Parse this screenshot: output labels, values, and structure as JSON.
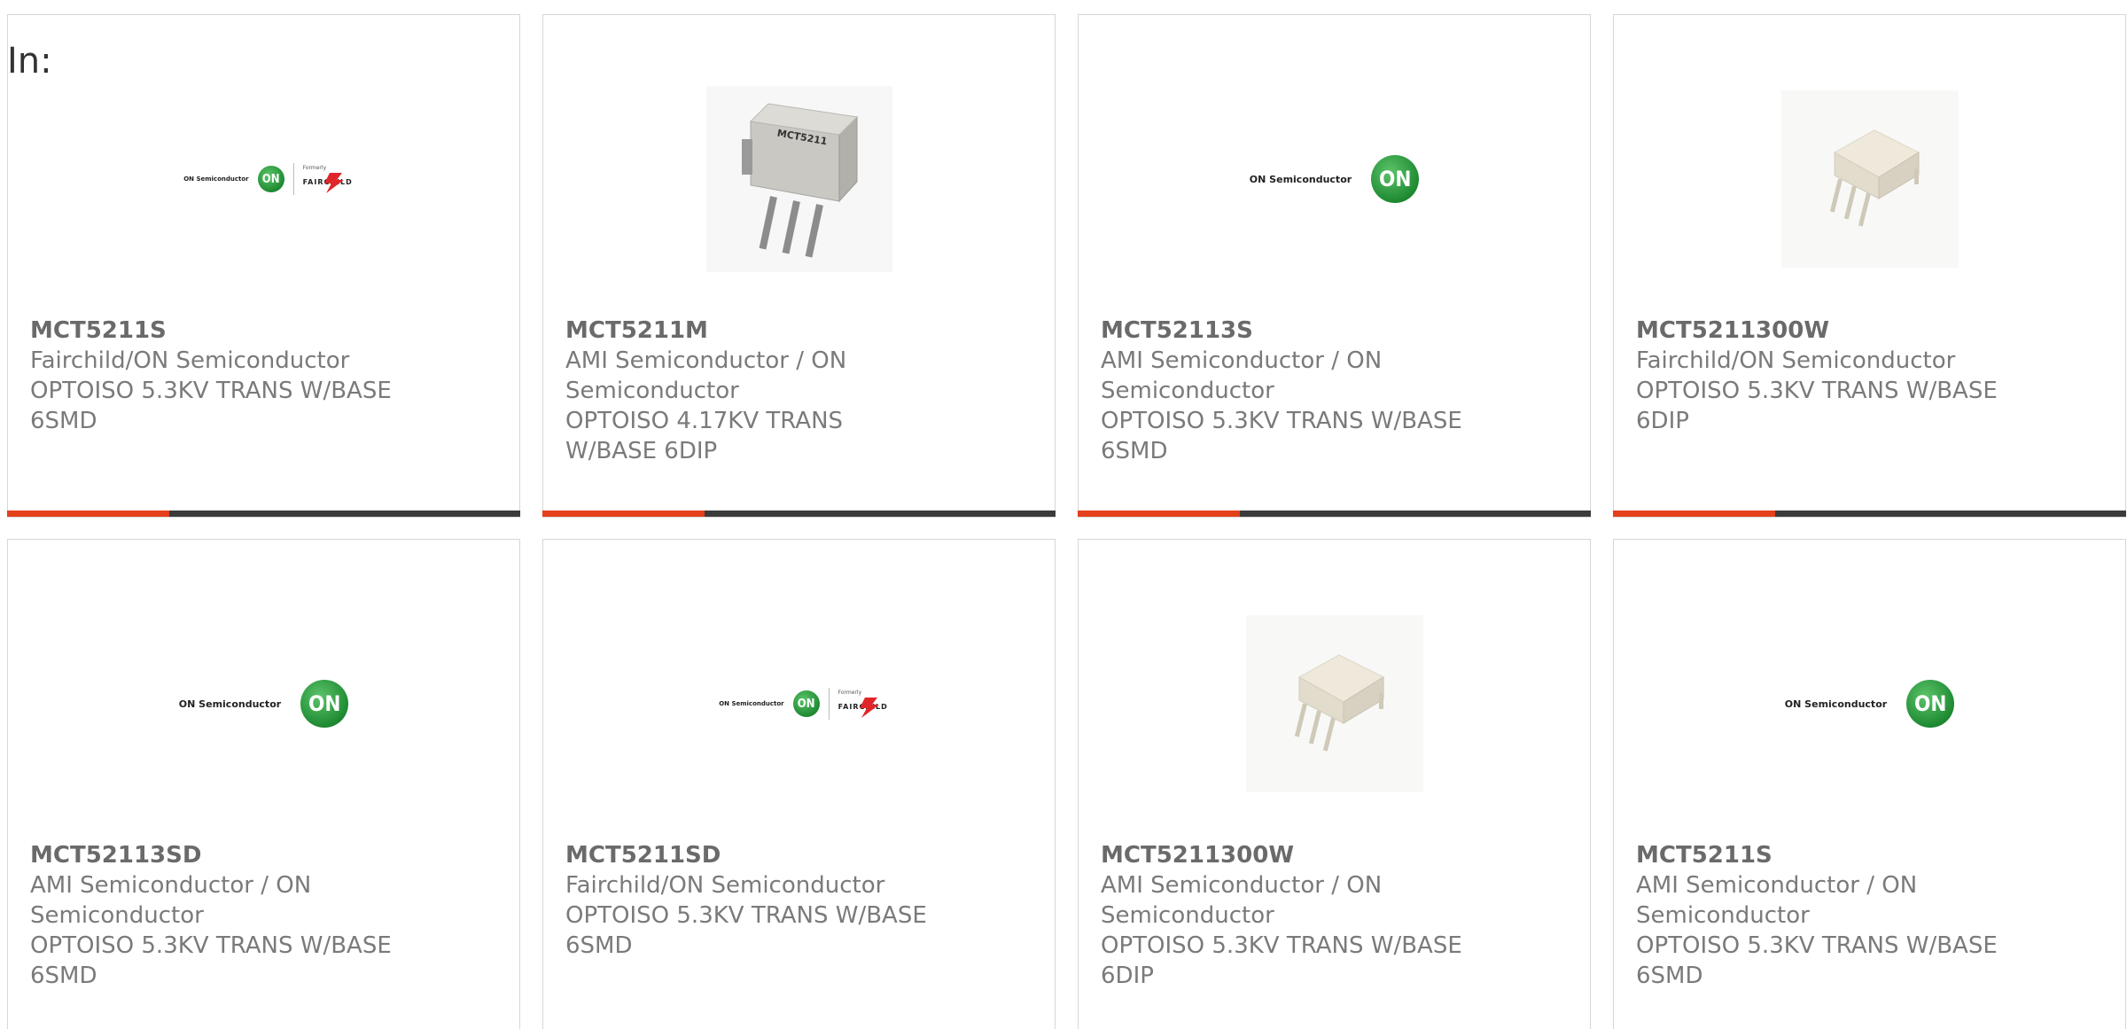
{
  "heading": "In:",
  "colors": {
    "accent": "#e4401b",
    "bar_dark": "#3b3b3b",
    "on_green": "#1e8a32",
    "fairchild_red": "#e0262a"
  },
  "logos": {
    "on_text": "ON Semiconductor",
    "on_mark": "ON",
    "fairchild_formerly": "Formerly",
    "fairchild_word": "FAIRCHILD",
    "chip_marking": "MCT5211"
  },
  "products": [
    {
      "image": "on-fairchild-logo",
      "part": "MCT5211S",
      "manufacturer": "Fairchild/ON Semiconductor",
      "description": "OPTOISO 5.3KV TRANS W/BASE 6SMD"
    },
    {
      "image": "gray-dip-chip",
      "part": "MCT5211M",
      "manufacturer": "AMI Semiconductor / ON Semiconductor",
      "description": "OPTOISO 4.17KV TRANS W/BASE 6DIP"
    },
    {
      "image": "on-logo",
      "part": "MCT52113S",
      "manufacturer": "AMI Semiconductor / ON Semiconductor",
      "description": "OPTOISO 5.3KV TRANS W/BASE 6SMD"
    },
    {
      "image": "white-dip-chip",
      "part": "MCT5211300W",
      "manufacturer": "Fairchild/ON Semiconductor",
      "description": "OPTOISO 5.3KV TRANS W/BASE 6DIP"
    },
    {
      "image": "on-logo",
      "part": "MCT52113SD",
      "manufacturer": "AMI Semiconductor / ON Semiconductor",
      "description": "OPTOISO 5.3KV TRANS W/BASE 6SMD"
    },
    {
      "image": "on-fairchild-logo",
      "part": "MCT5211SD",
      "manufacturer": "Fairchild/ON Semiconductor",
      "description": "OPTOISO 5.3KV TRANS W/BASE 6SMD"
    },
    {
      "image": "white-dip-chip",
      "part": "MCT5211300W",
      "manufacturer": "AMI Semiconductor / ON Semiconductor",
      "description": "OPTOISO 5.3KV TRANS W/BASE 6DIP"
    },
    {
      "image": "on-logo",
      "part": "MCT5211S",
      "manufacturer": "AMI Semiconductor / ON Semiconductor",
      "description": "OPTOISO 5.3KV TRANS W/BASE 6SMD"
    }
  ]
}
